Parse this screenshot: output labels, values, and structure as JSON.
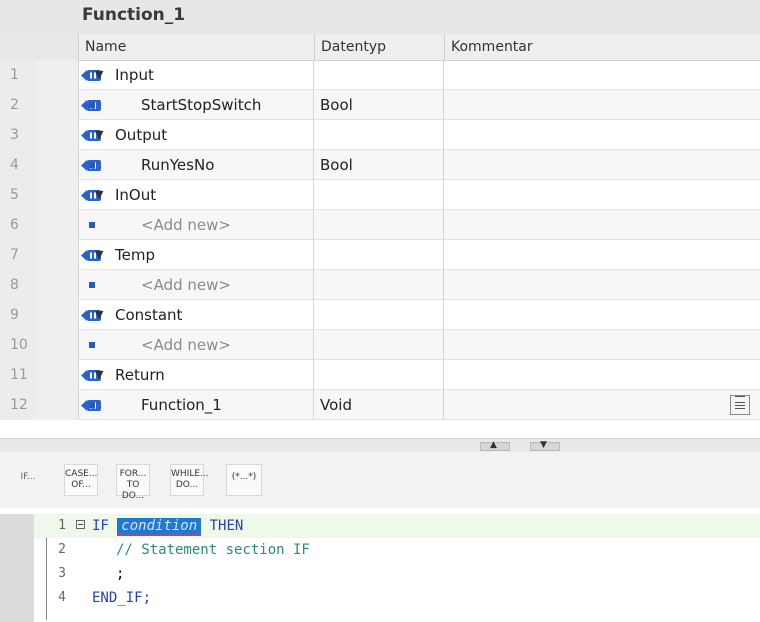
{
  "title": "Function_1",
  "table": {
    "headers": {
      "name": "Name",
      "datatype": "Datentyp",
      "comment": "Kommentar"
    },
    "rows": [
      {
        "num": "1",
        "kind": "section",
        "name": "Input",
        "datatype": "",
        "icon": true
      },
      {
        "num": "2",
        "kind": "item",
        "name": "StartStopSwitch",
        "datatype": "Bool",
        "icon": true
      },
      {
        "num": "3",
        "kind": "section",
        "name": "Output",
        "datatype": "",
        "icon": true
      },
      {
        "num": "4",
        "kind": "item",
        "name": "RunYesNo",
        "datatype": "Bool",
        "icon": true
      },
      {
        "num": "5",
        "kind": "section",
        "name": "InOut",
        "datatype": "",
        "icon": true
      },
      {
        "num": "6",
        "kind": "add",
        "name": "<Add new>",
        "datatype": "",
        "icon": false
      },
      {
        "num": "7",
        "kind": "section",
        "name": "Temp",
        "datatype": "",
        "icon": true
      },
      {
        "num": "8",
        "kind": "add",
        "name": "<Add new>",
        "datatype": "",
        "icon": false
      },
      {
        "num": "9",
        "kind": "section",
        "name": "Constant",
        "datatype": "",
        "icon": true
      },
      {
        "num": "10",
        "kind": "add",
        "name": "<Add new>",
        "datatype": "",
        "icon": false
      },
      {
        "num": "11",
        "kind": "section",
        "name": "Return",
        "datatype": "",
        "icon": true
      },
      {
        "num": "12",
        "kind": "item",
        "name": "Function_1",
        "datatype": "Void",
        "icon": true
      }
    ]
  },
  "toolbar": {
    "if_label": "IF...",
    "case_line1": "CASE...",
    "case_line2": "OF...",
    "for_line1": "FOR...",
    "for_line2": "TO DO...",
    "while_line1": "WHILE...",
    "while_line2": "DO...",
    "comment_label": "(*...*)"
  },
  "code": {
    "line1_num": "1",
    "line1_kw1": "IF",
    "line1_cond": "condition",
    "line1_kw2": "THEN",
    "line2_num": "2",
    "line2_comment": "// Statement section IF",
    "line3_num": "3",
    "line3_text": ";",
    "line4_num": "4",
    "line4_kw": "END_IF;"
  },
  "colors": {
    "accent": "#1f78d1",
    "keyword": "#2442b8",
    "comment": "#2c8a7a"
  }
}
